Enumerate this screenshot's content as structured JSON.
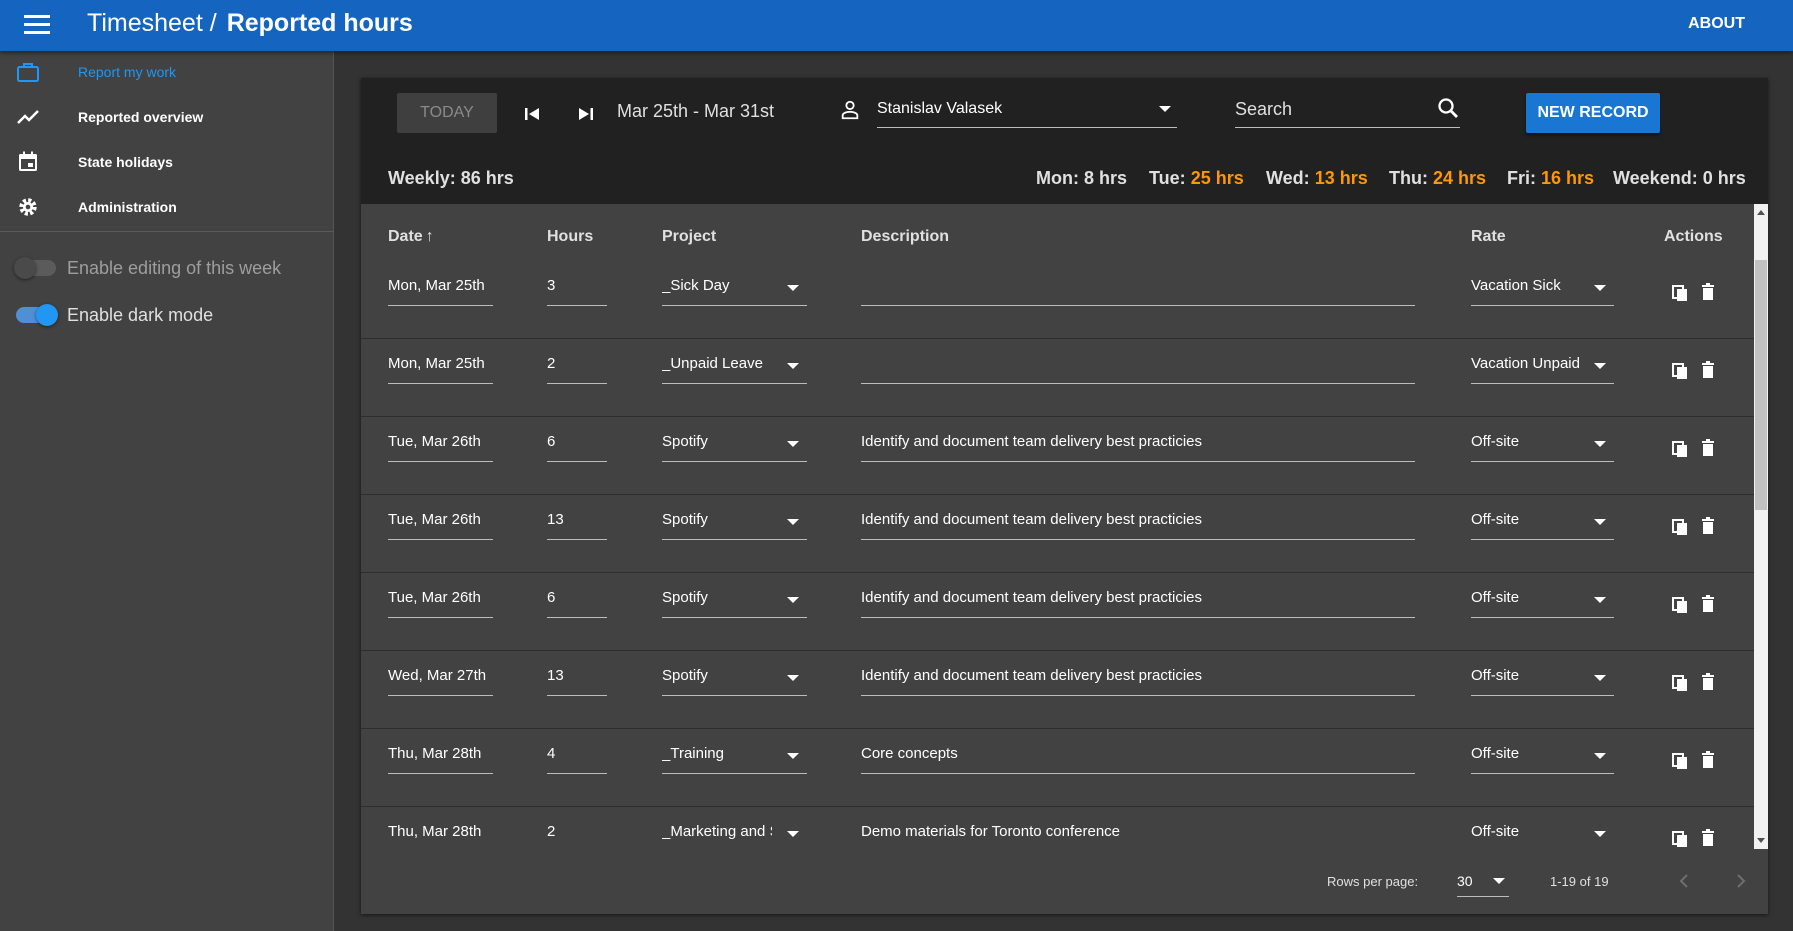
{
  "app": {
    "title": "Timesheet /",
    "subtitle": "Reported hours",
    "about_label": "ABOUT",
    "accent": "#1565c0"
  },
  "sidebar": {
    "items": [
      {
        "label": "Report my work",
        "icon": "briefcase-icon",
        "active": true
      },
      {
        "label": "Reported overview",
        "icon": "trending-up-icon"
      },
      {
        "label": "State holidays",
        "icon": "calendar-icon"
      },
      {
        "label": "Administration",
        "icon": "gear-icon"
      }
    ],
    "toggles": [
      {
        "label": "Enable editing of this week",
        "on": false,
        "disabled": true
      },
      {
        "label": "Enable dark mode",
        "on": true
      }
    ]
  },
  "toolbar": {
    "today_label": "TODAY",
    "range": "Mar 25th - Mar 31st",
    "user": "Stanislav Valasek",
    "search_placeholder": "Search",
    "new_record_label": "NEW RECORD"
  },
  "summary": {
    "weekly_label": "Weekly:",
    "weekly_value": "86 hrs",
    "mon_label": "Mon:",
    "mon_value": "8 hrs",
    "tue_label": "Tue:",
    "tue_value": "25 hrs",
    "wed_label": "Wed:",
    "wed_value": "13 hrs",
    "thu_label": "Thu:",
    "thu_value": "24 hrs",
    "fri_label": "Fri:",
    "fri_value": "16 hrs",
    "weekend_label": "Weekend:",
    "weekend_value": "0 hrs",
    "highlight_color": "#ff9800"
  },
  "table": {
    "headers": {
      "date": "Date",
      "hours": "Hours",
      "project": "Project",
      "description": "Description",
      "rate": "Rate",
      "actions": "Actions"
    },
    "rows": [
      {
        "date": "Mon, Mar 25th",
        "hours": "3",
        "project": "_Sick Day",
        "description": "",
        "rate": "Vacation Sick"
      },
      {
        "date": "Mon, Mar 25th",
        "hours": "2",
        "project": "_Unpaid Leave",
        "description": "",
        "rate": "Vacation Unpaid"
      },
      {
        "date": "Tue, Mar 26th",
        "hours": "6",
        "project": "Spotify",
        "description": "Identify and document team delivery best practicies",
        "rate": "Off-site"
      },
      {
        "date": "Tue, Mar 26th",
        "hours": "13",
        "project": "Spotify",
        "description": "Identify and document team delivery best practicies",
        "rate": "Off-site"
      },
      {
        "date": "Tue, Mar 26th",
        "hours": "6",
        "project": "Spotify",
        "description": "Identify and document team delivery best practicies",
        "rate": "Off-site"
      },
      {
        "date": "Wed, Mar 27th",
        "hours": "13",
        "project": "Spotify",
        "description": "Identify and document team delivery best practicies",
        "rate": "Off-site"
      },
      {
        "date": "Thu, Mar 28th",
        "hours": "4",
        "project": "_Training",
        "description": "Core concepts",
        "rate": "Off-site"
      },
      {
        "date": "Thu, Mar 28th",
        "hours": "2",
        "project": "_Marketing and Sales",
        "description": "Demo materials for Toronto conference",
        "rate": "Off-site"
      }
    ]
  },
  "footer": {
    "rows_per_page_label": "Rows per page:",
    "rows_per_page": "30",
    "range": "1-19 of 19"
  }
}
